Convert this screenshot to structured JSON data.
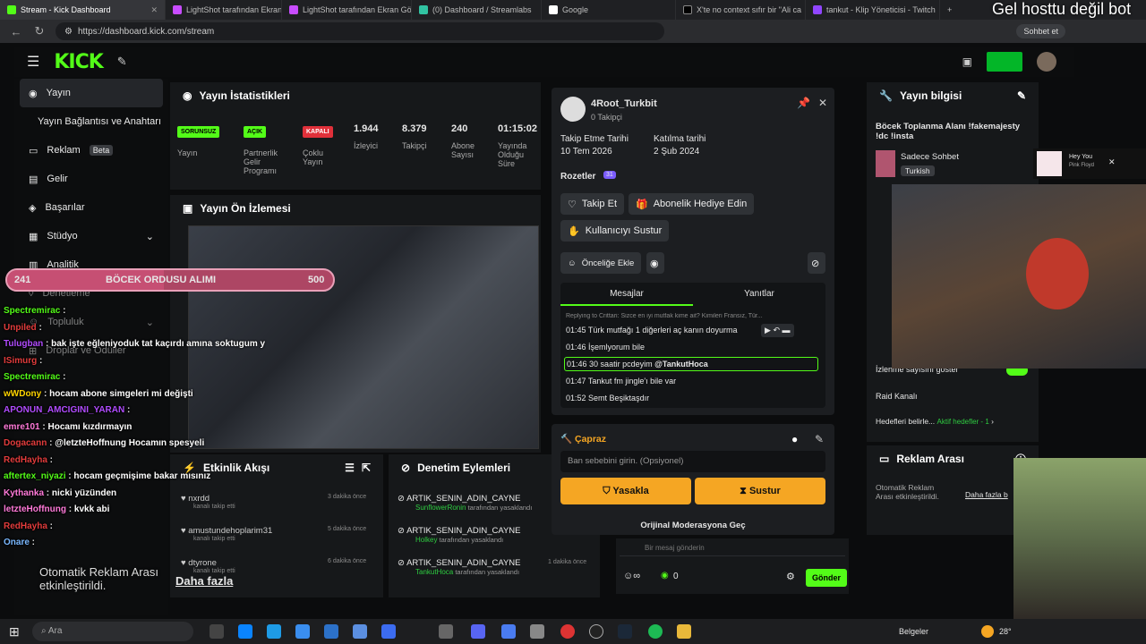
{
  "browser": {
    "tabs": [
      {
        "label": "Stream - Kick Dashboard",
        "active": true
      },
      {
        "label": "LightShot tarafından Ekran Gö"
      },
      {
        "label": "LightShot tarafından Ekran Gö"
      },
      {
        "label": "(0) Dashboard / Streamlabs"
      },
      {
        "label": "Google"
      },
      {
        "label": "X'te no context sıfır bir \"Ali ca"
      },
      {
        "label": "tankut - Klip Yöneticisi - Twitch"
      }
    ],
    "url": "https://dashboard.kick.com/stream",
    "profile_label": "Sohbet et"
  },
  "overlay": {
    "title": "Gel hosttu değil bot",
    "goal": {
      "current": "241",
      "label": "BÖCEK ORDUSU ALIMI",
      "target": "500",
      "progress": 0.48
    },
    "ad_text": "Otomatik Reklam Arası etkinleştirildi.",
    "more": "Daha fazla",
    "music": {
      "title": "Hey You",
      "artist": "Pink Floyd"
    }
  },
  "sidebar": {
    "items": [
      {
        "label": "Yayın",
        "active": true
      },
      {
        "label": "Yayın Bağlantısı ve Anahtarı"
      },
      {
        "label": "Reklam",
        "badge": "Beta"
      },
      {
        "label": "Gelir"
      },
      {
        "label": "Başarılar"
      },
      {
        "label": "Stüdyo"
      },
      {
        "label": "Analitik"
      },
      {
        "label": "Denetleme"
      },
      {
        "label": "Topluluk"
      },
      {
        "label": "Droplar ve Ödüller"
      }
    ]
  },
  "stats": {
    "title": "Yayın İstatistikleri",
    "items": [
      {
        "badge": "SORUNSUZ",
        "label": "Yayın"
      },
      {
        "badge": "AÇIK",
        "label": "Partnerlik Gelir Programı"
      },
      {
        "badge": "KAPALI",
        "label": "Çoklu Yayın"
      },
      {
        "value": "1.944",
        "label": "İzleyici"
      },
      {
        "value": "8.379",
        "label": "Takipçi"
      },
      {
        "value": "240",
        "label": "Abone Sayısı"
      },
      {
        "value": "01:15:02",
        "label": "Yayında Olduğu Süre"
      }
    ]
  },
  "preview": {
    "title": "Yayın Ön İzlemesi"
  },
  "activity": {
    "title": "Etkinlik Akışı",
    "rows": [
      {
        "name": "nxrdd",
        "sub": "kanalı takip etti",
        "time": "3 dakika önce"
      },
      {
        "name": "amustundehoplarim31",
        "sub": "kanalı takip etti",
        "time": "5 dakika önce"
      },
      {
        "name": "dtyrone",
        "sub": "kanalı takip etti",
        "time": "6 dakika önce"
      }
    ]
  },
  "moderation": {
    "title": "Denetim Eylemleri",
    "rows": [
      {
        "name": "ARTIK_SENIN_ADIN_CAYNE",
        "by": "SunflowerRonin",
        "rest": "tarafından yasaklandı",
        "time": ""
      },
      {
        "name": "ARTIK_SENIN_ADIN_CAYNE",
        "by": "Holkey",
        "rest": "tarafından yasaklandı",
        "time": ""
      },
      {
        "name": "ARTIK_SENIN_ADIN_CAYNE",
        "by": "TankutHoca",
        "rest": "tarafından yasaklandı",
        "time": "1 dakika önce"
      }
    ]
  },
  "user_card": {
    "username": "4Root_Turkbit",
    "followers": "0 Takipçi",
    "follow_date_label": "Takip Etme Tarihi",
    "follow_date": "10 Tem 2026",
    "join_label": "Katılma tarihi",
    "join_date": "2 Şub 2024",
    "badges_label": "Rozetler",
    "badge_count": "31",
    "follow_btn": "Takip Et",
    "gift_btn": "Abonelik Hediye Edin",
    "mute_btn": "Kullanıcıyı Sustur",
    "priority_btn": "Önceliğe Ekle",
    "tab_messages": "Mesajlar",
    "tab_replies": "Yanıtlar",
    "reply_preview": "Replying to Crittari: Sizce en iyi mutfak kime ait? Kimileri Fransız, Tür...",
    "messages": [
      {
        "time": "01:45",
        "text": "Türk mutfağı 1 diğerleri aç kanın doyurma"
      },
      {
        "time": "01:46",
        "text": "İşemlyorum bile"
      },
      {
        "time": "01:46",
        "text": "30 saatir pcdeyim",
        "mention": "@TankutHoca"
      },
      {
        "time": "01:47",
        "text": "Tankut fm jingle'ı bile var"
      },
      {
        "time": "01:52",
        "text": "Semt Beşiktaşdır"
      }
    ]
  },
  "ban": {
    "label": "Çapraz",
    "placeholder": "Ban sebebini girin. (Opsiyonel)",
    "ban_btn": "Yasakla",
    "timeout_btn": "Sustur",
    "switch": "Orijinal Moderasyona Geç"
  },
  "chat_input": {
    "placeholder": "Bir mesaj gönderin",
    "points": "0",
    "send": "Gönder"
  },
  "stream_info": {
    "title": "Yayın bilgisi",
    "stream_title": "Böcek Toplanma Alanı !fakemajesty !dc !insta",
    "category": "Sadece Sohbet",
    "lang": "Turkish",
    "rows": [
      "İzlenme sayısını göster",
      "Raid Kanalı",
      "Hedefleri belirle..."
    ],
    "goal_status": "Aktif hedefler - 1"
  },
  "ad_break": {
    "title": "Reklam Arası",
    "text": "Otomatik Reklam Arası etkinleştirildi.",
    "more": "Daha fazla b"
  },
  "overlay_chat": [
    {
      "user": "Spectremirac",
      "color": "#53fc18",
      "msg": ""
    },
    {
      "user": "Unpiled",
      "color": "#e23c3c",
      "msg": ""
    },
    {
      "user": "Tulugban",
      "color": "#b14cff",
      "msg": "bak işte eğleniyoduk tat kaçırdı amına soktugum y"
    },
    {
      "user": "ISimurg",
      "color": "#e23c3c",
      "msg": ""
    },
    {
      "user": "Spectremirac",
      "color": "#53fc18",
      "msg": ""
    },
    {
      "user": "wWDony",
      "color": "#ffd400",
      "msg": "hocam abone simgeleri mi değişti"
    },
    {
      "user": "APONUN_AMCIGINI_YARAN",
      "color": "#b14cff",
      "msg": ""
    },
    {
      "user": "emre101",
      "color": "#ff7ad9",
      "msg": "Hocamı kızdırmayın"
    },
    {
      "user": "Dogacann",
      "color": "#e23c3c",
      "msg": "@letzteHoffnung Hocamın spesyeli"
    },
    {
      "user": "RedHayha",
      "color": "#e23c3c",
      "msg": ""
    },
    {
      "user": "aftertex_niyazi",
      "color": "#53fc18",
      "msg": "hocam geçmişime bakar mısınız"
    },
    {
      "user": "Kythanka",
      "color": "#ff7ad9",
      "msg": "nicki yüzünden"
    },
    {
      "user": "letzteHoffnung",
      "color": "#ff7ad9",
      "msg": "kvkk abi"
    },
    {
      "user": "RedHayha",
      "color": "#e23c3c",
      "msg": ""
    },
    {
      "user": "Onare",
      "color": "#7ab8ff",
      "msg": ""
    }
  ],
  "taskbar": {
    "search": "Ara",
    "folder": "Belgeler",
    "temp": "28°"
  }
}
